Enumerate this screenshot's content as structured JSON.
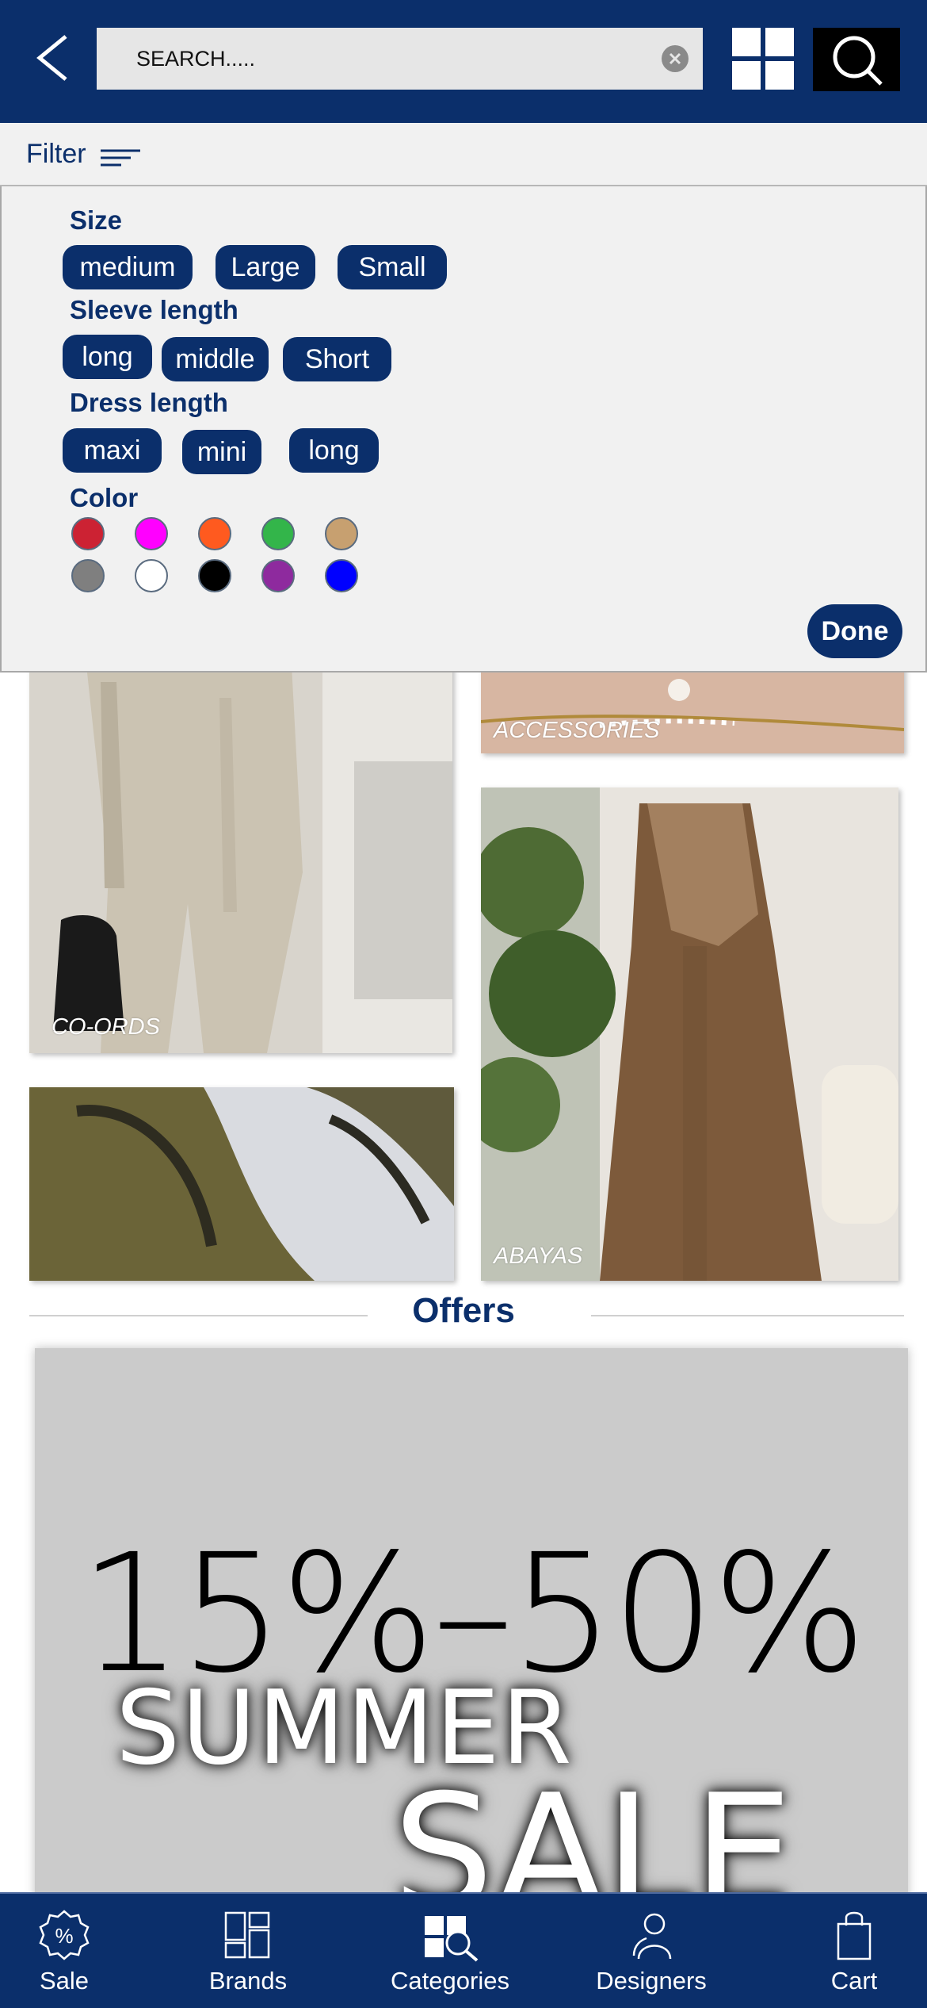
{
  "header": {
    "back_icon": "chevron-left-icon",
    "search_placeholder": "SEARCH.....",
    "clear_icon": "clear-circle-icon",
    "grid_icon": "grid-view-icon",
    "search_icon": "magnifier-icon"
  },
  "filter": {
    "label": "Filter",
    "icon": "filter-lines-icon",
    "sections": {
      "size": {
        "title": "Size",
        "options": [
          "medium",
          "Large",
          "Small"
        ]
      },
      "sleeve": {
        "title": "Sleeve length",
        "options": [
          "long",
          "middle",
          "Short"
        ]
      },
      "dress": {
        "title": "Dress length",
        "options": [
          "maxi",
          "mini",
          "long"
        ]
      },
      "color": {
        "title": "Color",
        "swatches": [
          "#cc2233",
          "#ff00ff",
          "#ff5a1f",
          "#33b54a",
          "#c7a070",
          "#7f7f7f",
          "#ffffff",
          "#000000",
          "#8e2a9e",
          "#0000ff"
        ]
      }
    },
    "done_label": "Done"
  },
  "categories": {
    "co_ords": "CO-ORDS",
    "accessories": "ACCESSORIES",
    "abayas": "ABAYAS",
    "shoes": ""
  },
  "offers": {
    "title": "Offers",
    "banner": {
      "range": "15%–50%",
      "line1": "SUMMER",
      "line2": "SALE"
    }
  },
  "bottom_nav": {
    "sale": "Sale",
    "brands": "Brands",
    "categories": "Categories",
    "designers": "Designers",
    "cart": "Cart"
  },
  "colors": {
    "brand_navy": "#0b2f6b",
    "panel_bg": "#f1f1f1",
    "banner_bg": "#cbcbcb"
  }
}
